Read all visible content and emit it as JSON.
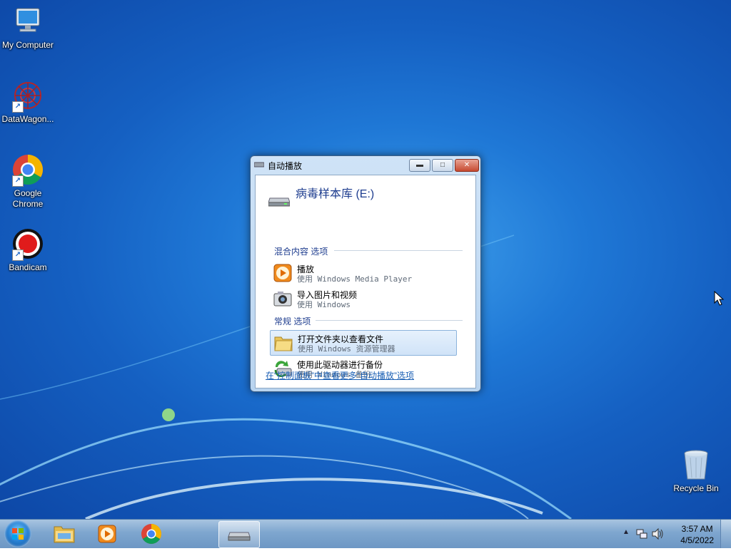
{
  "desktop": {
    "icons": [
      {
        "label": "My Computer",
        "icon": "computer-icon"
      },
      {
        "label": "DataWagon...",
        "icon": "datawagon-icon"
      },
      {
        "label": "Google Chrome",
        "icon": "chrome-icon"
      },
      {
        "label": "Bandicam",
        "icon": "bandicam-icon"
      },
      {
        "label": "Recycle Bin",
        "icon": "recycle-bin-icon"
      }
    ]
  },
  "autoplay": {
    "title": "自动播放",
    "drive_name": "病毒样本库 (E:)",
    "section_media": "混合内容 选项",
    "section_general": "常规 选项",
    "items": [
      {
        "main": "播放",
        "sub": "使用 Windows Media Player",
        "icon": "media-player-icon"
      },
      {
        "main": "导入图片和视频",
        "sub": "使用 Windows",
        "icon": "camera-icon"
      },
      {
        "main": "打开文件夹以查看文件",
        "sub": "使用 Windows 资源管理器",
        "icon": "folder-icon"
      },
      {
        "main": "使用此驱动器进行备份",
        "sub": "使用 Windows 备份",
        "icon": "backup-icon"
      }
    ],
    "control_panel_link": "在“控制面板”中查看更多“自动播放”选项"
  },
  "taskbar": {
    "pinned": [
      "explorer-icon",
      "media-player-icon",
      "chrome-icon",
      "drive-icon"
    ],
    "time": "3:57 AM",
    "date": "4/5/2022"
  }
}
